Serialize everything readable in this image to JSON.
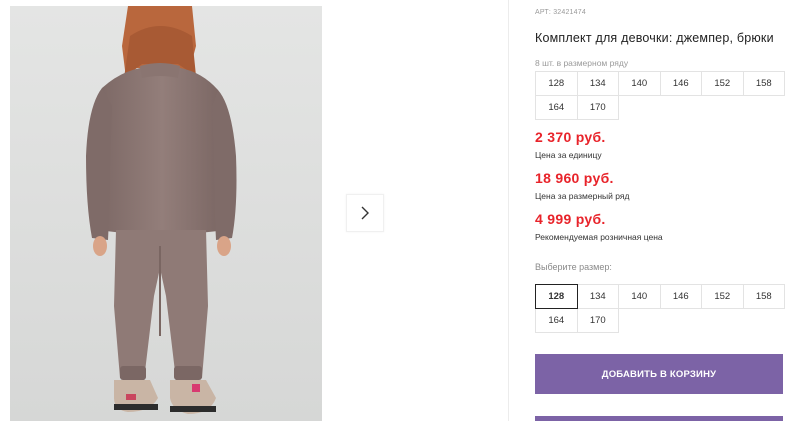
{
  "product": {
    "sku": "АРТ: 32421474",
    "title": "Комплект для девочки: джемпер, брюки",
    "pack_label": "8 шт. в размерном ряду",
    "pack_sizes": [
      "128",
      "134",
      "140",
      "146",
      "152",
      "158",
      "164",
      "170"
    ]
  },
  "prices": [
    {
      "value": "2 370 руб.",
      "note": "Цена за единицу"
    },
    {
      "value": "18 960 руб.",
      "note": "Цена за размерный ряд"
    },
    {
      "value": "4 999 руб.",
      "note": "Рекомендуемая розничная цена"
    }
  ],
  "size_selector": {
    "label": "Выберите размер:",
    "options": [
      "128",
      "134",
      "140",
      "146",
      "152",
      "158",
      "164",
      "170"
    ],
    "selected": "128"
  },
  "actions": {
    "add_to_cart": "ДОБАВИТЬ В КОРЗИНУ"
  },
  "gallery": {
    "next_icon": "chevron-right-icon",
    "image_subject": "girl in knitted jumper and trousers, back view"
  },
  "colors": {
    "price": "#e8232a",
    "accent_button": "#7c63a6",
    "photo_background": "#dfe0df",
    "knit": "#8c7672"
  }
}
